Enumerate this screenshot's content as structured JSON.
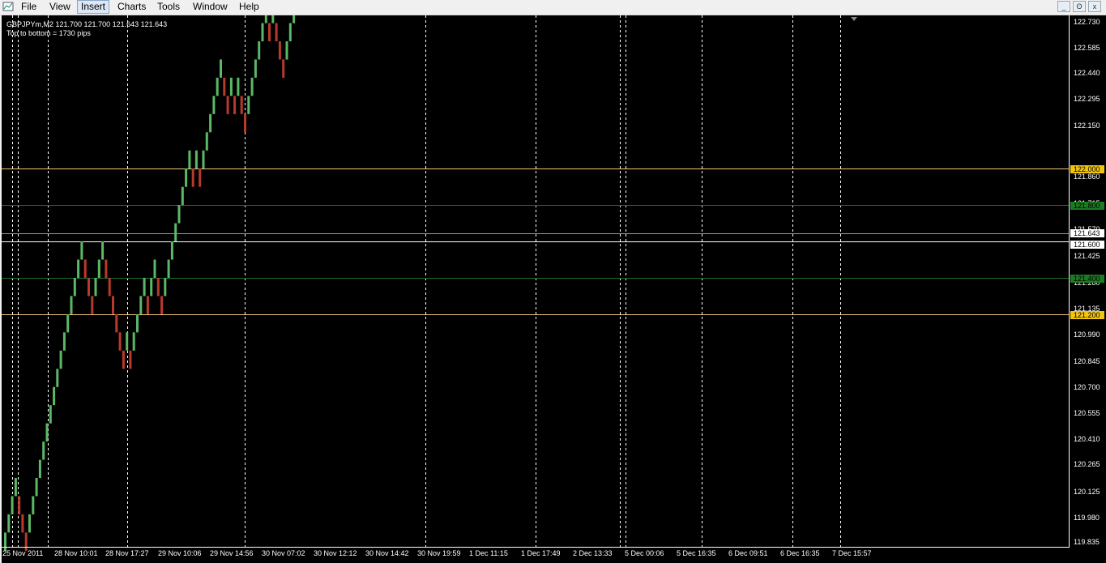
{
  "menu": [
    "File",
    "View",
    "Insert",
    "Charts",
    "Tools",
    "Window",
    "Help"
  ],
  "active_menu": "Insert",
  "window_buttons": [
    "_",
    "ʘ",
    "x"
  ],
  "chart": {
    "symbol_line": "GBPJPYm,M2  121.700 121.700 121.643 121.643",
    "info_line": "Top to bottom = 1730 pips",
    "current_price": "121.643",
    "colors": {
      "background": "#000000",
      "up_brick": "#5bb866",
      "down_brick": "#b83a2c",
      "orange_line": "#f3c479",
      "green_line": "#1d6e26",
      "white_line": "#ffffff"
    }
  },
  "price_ticks": [
    "122.730",
    "122.585",
    "122.440",
    "122.295",
    "122.150",
    "121.860",
    "121.715",
    "121.570",
    "121.425",
    "121.280",
    "121.135",
    "120.990",
    "120.845",
    "120.700",
    "120.555",
    "120.410",
    "120.265",
    "120.125",
    "119.980",
    "119.835"
  ],
  "price_levels": [
    {
      "label": "122.000",
      "type": "orange"
    },
    {
      "label": "121.800",
      "type": "green"
    },
    {
      "label": "121.643",
      "type": "current"
    },
    {
      "label": "121.600",
      "type": "white"
    },
    {
      "label": "121.400",
      "type": "green"
    },
    {
      "label": "121.200",
      "type": "orange"
    }
  ],
  "time_labels": [
    "25 Nov 2011",
    "28 Nov 10:01",
    "28 Nov 17:27",
    "29 Nov 10:06",
    "29 Nov 14:56",
    "30 Nov 07:02",
    "30 Nov 12:12",
    "30 Nov 14:42",
    "30 Nov 19:59",
    "1 Dec 11:15",
    "1 Dec 17:49",
    "2 Dec 13:33",
    "5 Dec 00:06",
    "5 Dec 16:35",
    "6 Dec 09:51",
    "6 Dec 16:35",
    "7 Dec 15:57"
  ],
  "renko": {
    "brick_size_pips": 10,
    "start_price": 119.9,
    "directions": "UUUUDDDUUUUUUUUUUUUUUUUDDDUUUDDDDDDUDUUUUDUUDDUUUUUUUUDUDUUUUUUDDUDUDDUUUUUUDUDDDUUUUUUUUUUUUUUUUUDDDDDDDUUUDDDUUUUUUUUUUUUUUDDDDUUUDUDUUUUUUUDUUUUUUDDDUUUUUUUUUUUUDDDDDDDDDDDDDDDDUUUDUUUDUUDDDDUUUUUUUUUUUUUDDDDDDDDDDDDDUDDUUUUUUUDUUUUUUUDDDDUDUUDDDUUUDDDDDDDDDDDUUUUUUUUUUUUUUUUUDDDDD"
  }
}
